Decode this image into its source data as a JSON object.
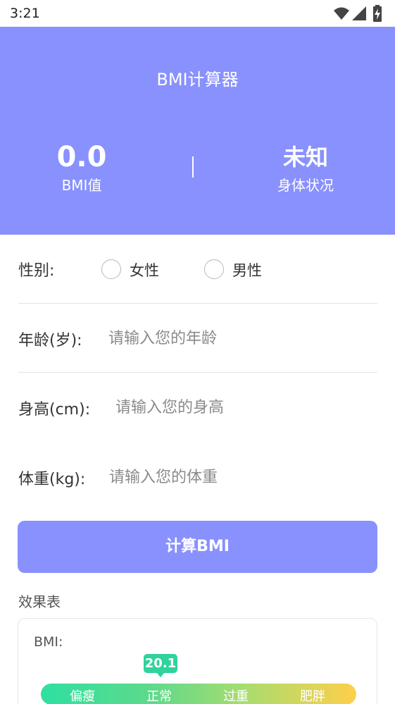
{
  "status_bar": {
    "time": "3:21"
  },
  "header": {
    "title": "BMI计算器",
    "bmi_value": "0.0",
    "bmi_label": "BMI值",
    "status_value": "未知",
    "status_label": "身体状况"
  },
  "form": {
    "gender": {
      "label": "性别:",
      "options": [
        "女性",
        "男性"
      ],
      "selected": ""
    },
    "age": {
      "label": "年龄(岁):",
      "value": "",
      "placeholder": "请输入您的年龄"
    },
    "height": {
      "label": "身高(cm):",
      "value": "",
      "placeholder": "请输入您的身高"
    },
    "weight": {
      "label": "体重(kg):",
      "value": "",
      "placeholder": "请输入您的体重"
    }
  },
  "calculate_button": {
    "label": "计算BMI"
  },
  "result_table": {
    "title": "效果表",
    "bmi_label": "BMI:",
    "marker_value": "20.1",
    "categories": [
      "偏瘦",
      "正常",
      "过重",
      "肥胖"
    ]
  },
  "colors": {
    "primary": "#8891fd",
    "marker": "#2fd39b",
    "scale_start": "#2ee0a1",
    "scale_end": "#ffcf4a"
  },
  "icons": [
    "wifi-icon",
    "signal-icon",
    "battery-charging-icon"
  ]
}
